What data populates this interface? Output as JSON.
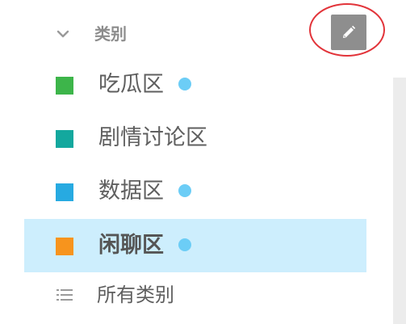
{
  "section": {
    "title": "类别",
    "toggle_icon": "chevron-down-icon",
    "edit_icon": "pencil-icon"
  },
  "categories": [
    {
      "label": "吃瓜区",
      "color": "#3db54a",
      "unread": true,
      "active": false
    },
    {
      "label": "剧情讨论区",
      "color": "#13a89e",
      "unread": false,
      "active": false
    },
    {
      "label": "数据区",
      "color": "#27aae1",
      "unread": true,
      "active": false
    },
    {
      "label": "闲聊区",
      "color": "#f7941d",
      "unread": true,
      "active": true
    }
  ],
  "all_categories": {
    "label": "所有类别",
    "icon": "list-icon"
  },
  "colors": {
    "accent_highlight": "#e2343a",
    "active_row": "#cdeefd",
    "unread_dot": "#6ccdf6"
  }
}
